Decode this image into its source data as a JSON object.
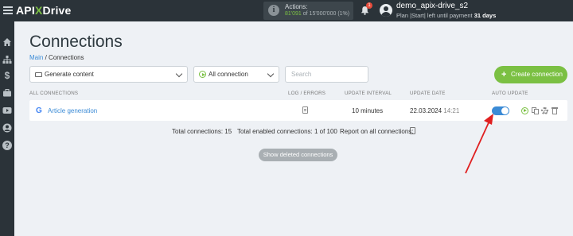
{
  "header": {
    "logo_prefix": "API",
    "logo_x": "X",
    "logo_suffix": "Drive",
    "actions_label": "Actions:",
    "actions_used": "81'091",
    "actions_total": "of 15'000'000",
    "actions_percent": "(1%)",
    "notifications_count": "1",
    "user_name": "demo_apix-drive_s2",
    "plan_text": "Plan |Start| left until payment",
    "plan_days": "31 days"
  },
  "sidebar": {
    "items": [
      "home-icon",
      "sitemap-icon",
      "dollar-icon",
      "briefcase-icon",
      "video-icon",
      "user-icon",
      "help-icon"
    ]
  },
  "page": {
    "title": "Connections",
    "breadcrumb_main": "Main",
    "breadcrumb_sep": "/",
    "breadcrumb_current": "Connections"
  },
  "filters": {
    "folder_value": "Generate content",
    "connection_filter_value": "All connection",
    "search_placeholder": "Search",
    "create_label": "Create connection"
  },
  "table": {
    "columns": {
      "all": "ALL CONNECTIONS",
      "log": "LOG / ERRORS",
      "interval": "UPDATE INTERVAL",
      "date": "UPDATE DATE",
      "auto": "AUTO UPDATE"
    },
    "rows": [
      {
        "name": "Article generation",
        "interval": "10 minutes",
        "date": "22.03.2024",
        "time": "14:21",
        "auto_update": true
      }
    ]
  },
  "totals": {
    "total": "Total connections: 15",
    "enabled": "Total enabled connections: 1 of 100",
    "report": "Report on all connections:"
  },
  "show_deleted_label": "Show deleted connections",
  "colors": {
    "accent_green": "#7bc043",
    "accent_blue": "#3b8bd6",
    "topbar": "#2b3339",
    "arrow": "#e02020"
  }
}
